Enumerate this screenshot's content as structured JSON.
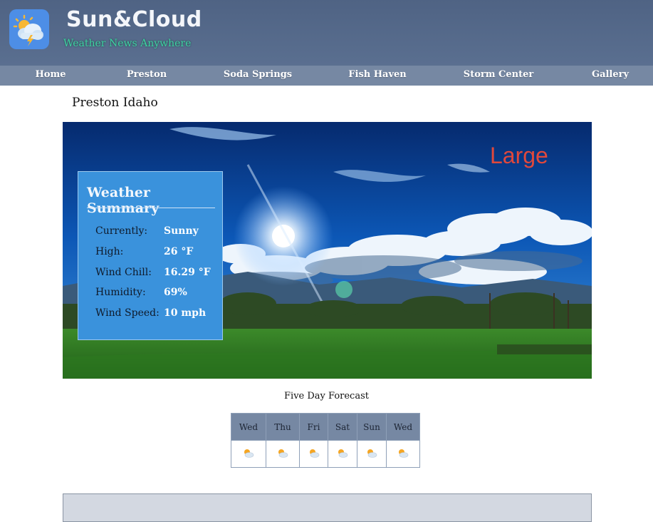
{
  "header": {
    "title": "Sun&Cloud",
    "tagline": "Weather News Anywhere",
    "logo_icon": "sun-cloud-lightning-icon",
    "background": "#5a6f90",
    "tagline_color": "#3fd2a4"
  },
  "nav": {
    "items": [
      {
        "label": "Home"
      },
      {
        "label": "Preston"
      },
      {
        "label": "Soda Springs"
      },
      {
        "label": "Fish Haven"
      },
      {
        "label": "Storm Center"
      },
      {
        "label": "Gallery"
      }
    ],
    "background": "#7688a3"
  },
  "page": {
    "heading": "Preston Idaho"
  },
  "hero": {
    "overlay_text": "Large",
    "overlay_color": "#e0483c",
    "image_subject": "sun-over-green-field-photo"
  },
  "summary": {
    "title": "Weather Summary",
    "background": "#3a92dc",
    "rows": [
      {
        "label": "Currently:",
        "value": "Sunny"
      },
      {
        "label": "High:",
        "value": "26 °F"
      },
      {
        "label": "Wind Chill:",
        "value": "16.29 °F"
      },
      {
        "label": "Humidity:",
        "value": "69%"
      },
      {
        "label": "Wind Speed:",
        "value": "10 mph"
      }
    ]
  },
  "forecast": {
    "title": "Five Day Forecast",
    "days": [
      {
        "day": "Wed",
        "icon": "partly-cloudy-icon"
      },
      {
        "day": "Thu",
        "icon": "partly-cloudy-icon"
      },
      {
        "day": "Fri",
        "icon": "partly-cloudy-icon"
      },
      {
        "day": "Sat",
        "icon": "partly-cloudy-icon"
      },
      {
        "day": "Sun",
        "icon": "partly-cloudy-icon"
      },
      {
        "day": "Wed",
        "icon": "partly-cloudy-icon"
      }
    ]
  }
}
